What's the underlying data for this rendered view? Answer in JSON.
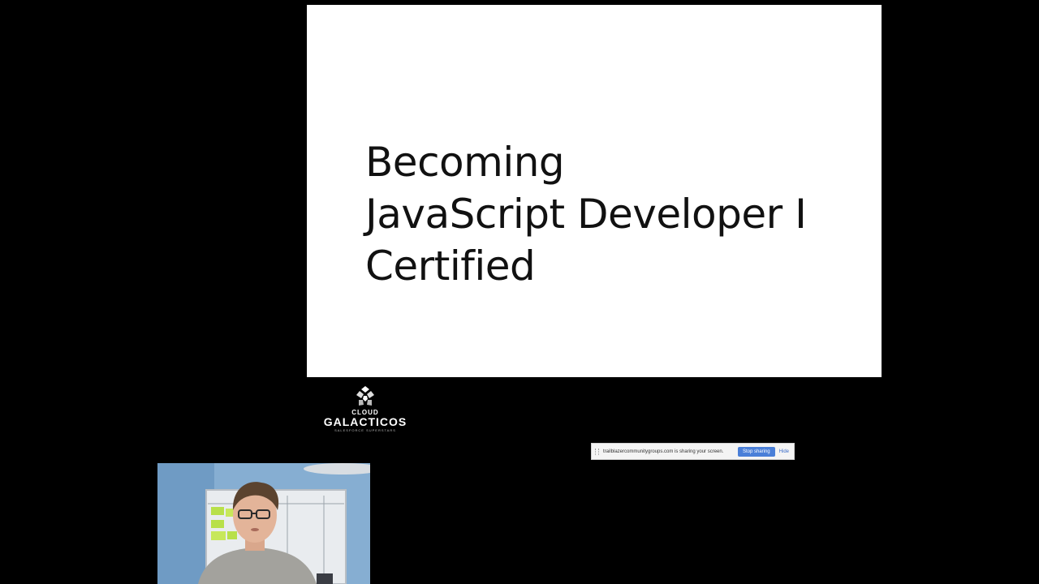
{
  "slide": {
    "title_lines": [
      "Becoming",
      "JavaScript Developer I",
      "Certified"
    ]
  },
  "logo": {
    "line1": "CLOUD",
    "line2": "GALACTICOS",
    "tagline": "SALESFORCE SUPERSTARS"
  },
  "share_bar": {
    "message": "trailblazercommunitygroups.com is sharing your screen.",
    "stop_label": "Stop sharing",
    "hide_label": "Hide"
  },
  "webcam": {
    "icon": "webcam-feed"
  }
}
